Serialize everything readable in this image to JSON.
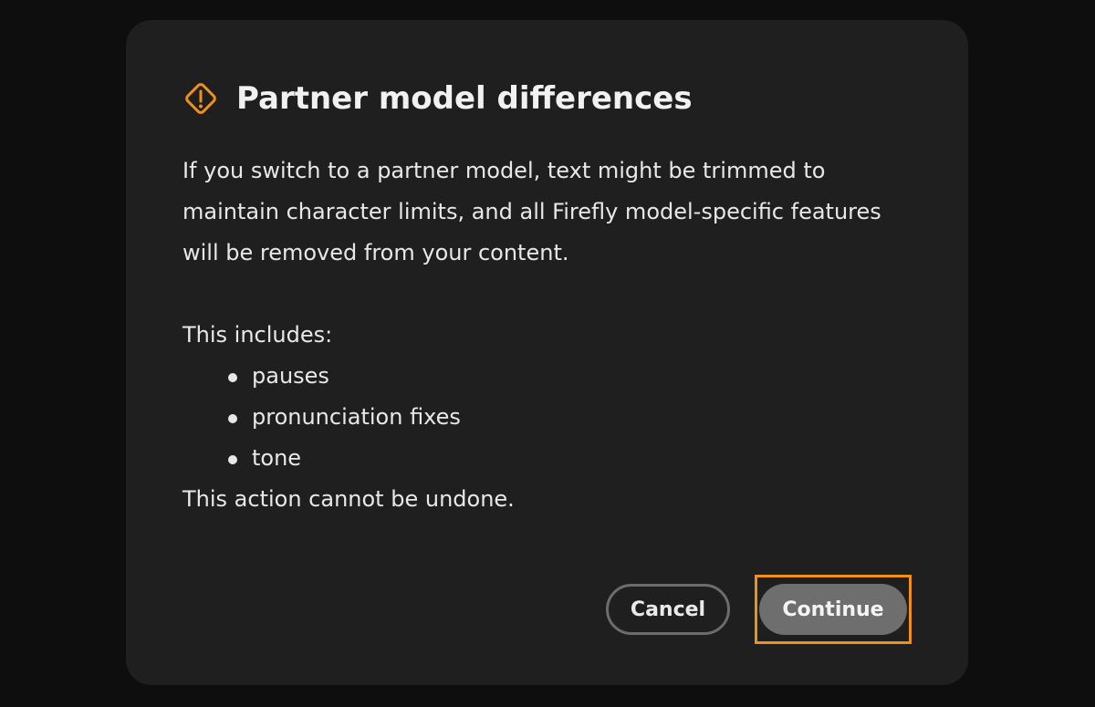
{
  "dialog": {
    "title": "Partner model differences",
    "icon": "warning-diamond-icon",
    "accent_color": "#f0901c",
    "paragraph": "If you switch to a partner model, text might be trimmed to maintain character limits, and all Firefly model-specific features will be removed from your content.",
    "includes_label": "This includes:",
    "bullets": [
      "pauses",
      "pronunciation fixes",
      "tone"
    ],
    "footer_note": "This action cannot be undone.",
    "buttons": {
      "cancel_label": "Cancel",
      "continue_label": "Continue"
    }
  }
}
